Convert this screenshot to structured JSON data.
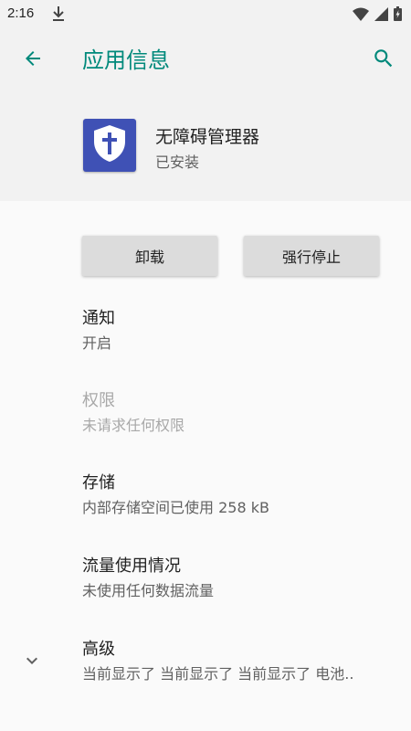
{
  "status_bar": {
    "time": "2:16",
    "icons": [
      "download-icon",
      "wifi-icon",
      "signal-icon",
      "battery-icon"
    ]
  },
  "app_bar": {
    "title": "应用信息",
    "back_icon": "arrow-back-icon",
    "search_icon": "search-icon"
  },
  "app": {
    "name": "无障碍管理器",
    "status": "已安装",
    "icon": "shield-cross-icon"
  },
  "buttons": {
    "uninstall": "卸载",
    "force_stop": "强行停止"
  },
  "preferences": [
    {
      "title": "通知",
      "summary": "开启",
      "enabled": true
    },
    {
      "title": "权限",
      "summary": "未请求任何权限",
      "enabled": false
    },
    {
      "title": "存储",
      "summary": "内部存储空间已使用 258 kB",
      "enabled": true
    },
    {
      "title": "流量使用情况",
      "summary": "未使用任何数据流量",
      "enabled": true
    },
    {
      "title": "高级",
      "summary": "当前显示了 当前显示了 当前显示了 电池..",
      "enabled": true
    }
  ],
  "colors": {
    "accent": "#00897b",
    "app_icon_bg": "#3f51b5",
    "header_bg": "#f2f2f2",
    "body_bg": "#fafafa"
  }
}
